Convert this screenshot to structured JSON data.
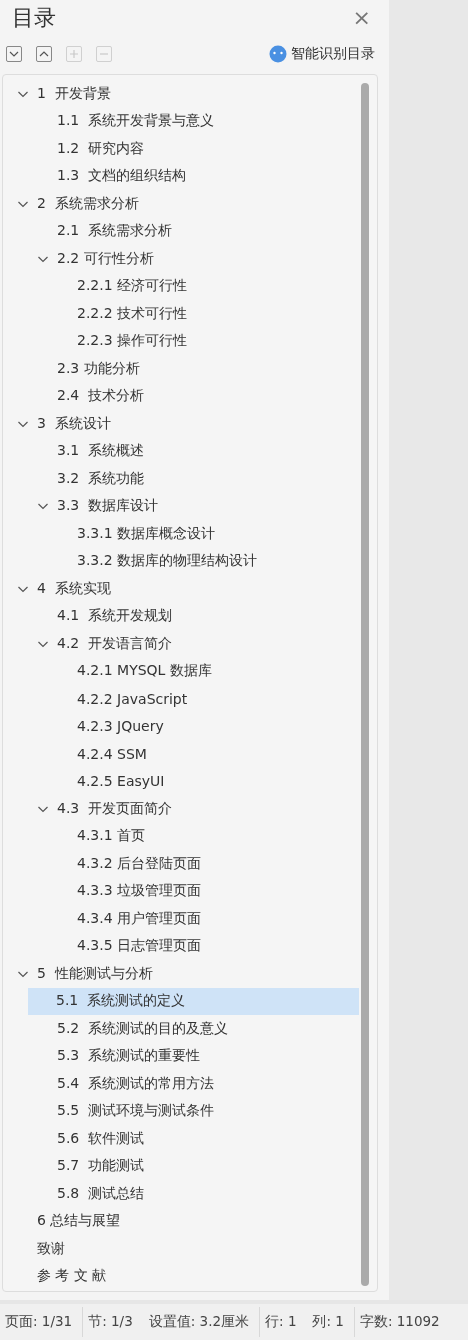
{
  "panel": {
    "title": "目录",
    "close": "×"
  },
  "toolbar": [
    {
      "kind": "expand",
      "disabled": false
    },
    {
      "kind": "collapse",
      "disabled": false
    },
    {
      "kind": "add",
      "disabled": true
    },
    {
      "kind": "remove",
      "disabled": true
    }
  ],
  "smart_button": {
    "label": "智能识别目录"
  },
  "toc": [
    {
      "label": "1  开发背景",
      "expanded": true,
      "selected": false,
      "children": [
        {
          "label": "1.1  系统开发背景与意义",
          "selected": false
        },
        {
          "label": "1.2  研究内容",
          "selected": false
        },
        {
          "label": "1.3  文档的组织结构",
          "selected": false
        }
      ]
    },
    {
      "label": "2  系统需求分析",
      "expanded": true,
      "selected": false,
      "children": [
        {
          "label": "2.1  系统需求分析",
          "selected": false
        },
        {
          "label": "2.2 可行性分析",
          "expanded": true,
          "selected": false,
          "children": [
            {
              "label": "2.2.1 经济可行性",
              "selected": false
            },
            {
              "label": "2.2.2 技术可行性",
              "selected": false
            },
            {
              "label": "2.2.3 操作可行性",
              "selected": false
            }
          ]
        },
        {
          "label": "2.3 功能分析",
          "selected": false
        },
        {
          "label": "2.4  技术分析",
          "selected": false
        }
      ]
    },
    {
      "label": "3  系统设计",
      "expanded": true,
      "selected": false,
      "children": [
        {
          "label": "3.1  系统概述",
          "selected": false
        },
        {
          "label": "3.2  系统功能",
          "selected": false
        },
        {
          "label": "3.3  数据库设计",
          "expanded": true,
          "selected": false,
          "children": [
            {
              "label": "3.3.1 数据库概念设计",
              "selected": false
            },
            {
              "label": "3.3.2 数据库的物理结构设计",
              "selected": false
            }
          ]
        }
      ]
    },
    {
      "label": "4  系统实现",
      "expanded": true,
      "selected": false,
      "children": [
        {
          "label": "4.1  系统开发规划",
          "selected": false
        },
        {
          "label": "4.2  开发语言简介",
          "expanded": true,
          "selected": false,
          "children": [
            {
              "label": "4.2.1 MYSQL 数据库",
              "selected": false
            },
            {
              "label": "4.2.2 JavaScript",
              "selected": false
            },
            {
              "label": "4.2.3 JQuery",
              "selected": false
            },
            {
              "label": "4.2.4 SSM",
              "selected": false
            },
            {
              "label": "4.2.5 EasyUI",
              "selected": false
            }
          ]
        },
        {
          "label": "4.3  开发页面简介",
          "expanded": true,
          "selected": false,
          "children": [
            {
              "label": "4.3.1 首页",
              "selected": false
            },
            {
              "label": "4.3.2 后台登陆页面",
              "selected": false
            },
            {
              "label": "4.3.3 垃圾管理页面",
              "selected": false
            },
            {
              "label": "4.3.4 用户管理页面",
              "selected": false
            },
            {
              "label": "4.3.5 日志管理页面",
              "selected": false
            }
          ]
        }
      ]
    },
    {
      "label": "5  性能测试与分析",
      "expanded": true,
      "selected": false,
      "children": [
        {
          "label": "5.1  系统测试的定义",
          "selected": true
        },
        {
          "label": "5.2  系统测试的目的及意义",
          "selected": false
        },
        {
          "label": "5.3  系统测试的重要性",
          "selected": false
        },
        {
          "label": "5.4  系统测试的常用方法",
          "selected": false
        },
        {
          "label": "5.5  测试环境与测试条件",
          "selected": false
        },
        {
          "label": "5.6  软件测试",
          "selected": false
        },
        {
          "label": "5.7  功能测试",
          "selected": false
        },
        {
          "label": "5.8  测试总结",
          "selected": false
        }
      ]
    },
    {
      "label": "6 总结与展望",
      "selected": false
    },
    {
      "label": "致谢",
      "selected": false
    },
    {
      "label": "参 考 文 献",
      "selected": false
    }
  ],
  "status_bar": [
    [
      "页面: 1/31"
    ],
    [
      "节: 1/3",
      "设置值: 3.2厘米"
    ],
    [
      "行: 1",
      "列: 1"
    ],
    [
      "字数: 11092"
    ]
  ]
}
